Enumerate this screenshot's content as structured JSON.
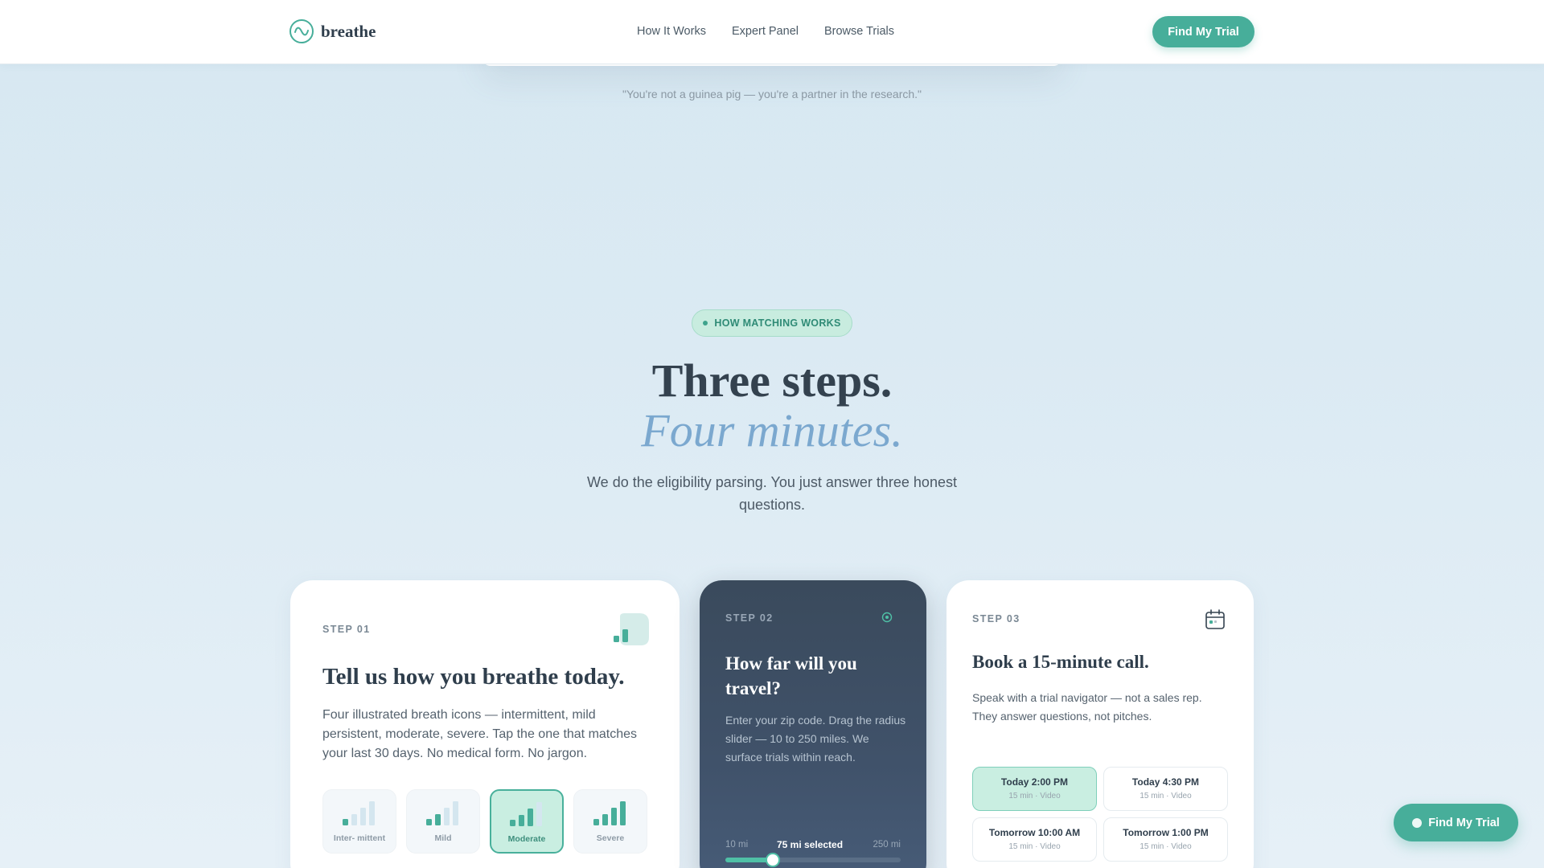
{
  "header": {
    "logo_text": "breathe",
    "nav": [
      "How It Works",
      "Expert Panel",
      "Browse Trials"
    ],
    "cta_label": "Find My Trial"
  },
  "quote": "\"You're not a guinea pig — you're a partner in the research.\"",
  "section": {
    "pill": "HOW MATCHING WORKS",
    "title": "Three steps.",
    "subtitle": "Four minutes.",
    "description": "We do the eligibility parsing. You just answer three honest questions."
  },
  "step1": {
    "label": "STEP 01",
    "title": "Tell us how you breathe today.",
    "description": "Four illustrated breath icons — intermittent, mild persistent, moderate, severe. Tap the one that matches your last 30 days. No medical form. No jargon.",
    "options": [
      {
        "label": "Inter- mittent",
        "level": 1
      },
      {
        "label": "Mild",
        "level": 2
      },
      {
        "label": "Moderate",
        "level": 3,
        "selected": true
      },
      {
        "label": "Severe",
        "level": 4
      }
    ]
  },
  "step2": {
    "label": "STEP 02",
    "title": "How far will you travel?",
    "description": "Enter your zip code. Drag the radius slider — 10 to 250 miles. We surface trials within reach.",
    "range_min_label": "10 mi",
    "range_max_label": "250 mi",
    "selected_label": "75 mi selected",
    "min": 10,
    "max": 250,
    "value": 75
  },
  "step3": {
    "label": "STEP 03",
    "title": "Book a 15-minute call.",
    "description": "Speak with a trial navigator — not a sales rep. They answer questions, not pitches.",
    "slots": [
      {
        "time": "Today 2:00 PM",
        "meta": "15 min · Video",
        "selected": true
      },
      {
        "time": "Today 4:30 PM",
        "meta": "15 min · Video"
      },
      {
        "time": "Tomorrow 10:00 AM",
        "meta": "15 min · Video"
      },
      {
        "time": "Tomorrow 1:00 PM",
        "meta": "15 min · Video"
      }
    ]
  },
  "floating_cta": "Find My Trial",
  "colors": {
    "accent": "#47ae9a",
    "accent_light": "#c9eee1",
    "heading": "#2f3e4c",
    "italic_blue": "#7ba8cf",
    "dark_card": "#3a4a5c"
  }
}
